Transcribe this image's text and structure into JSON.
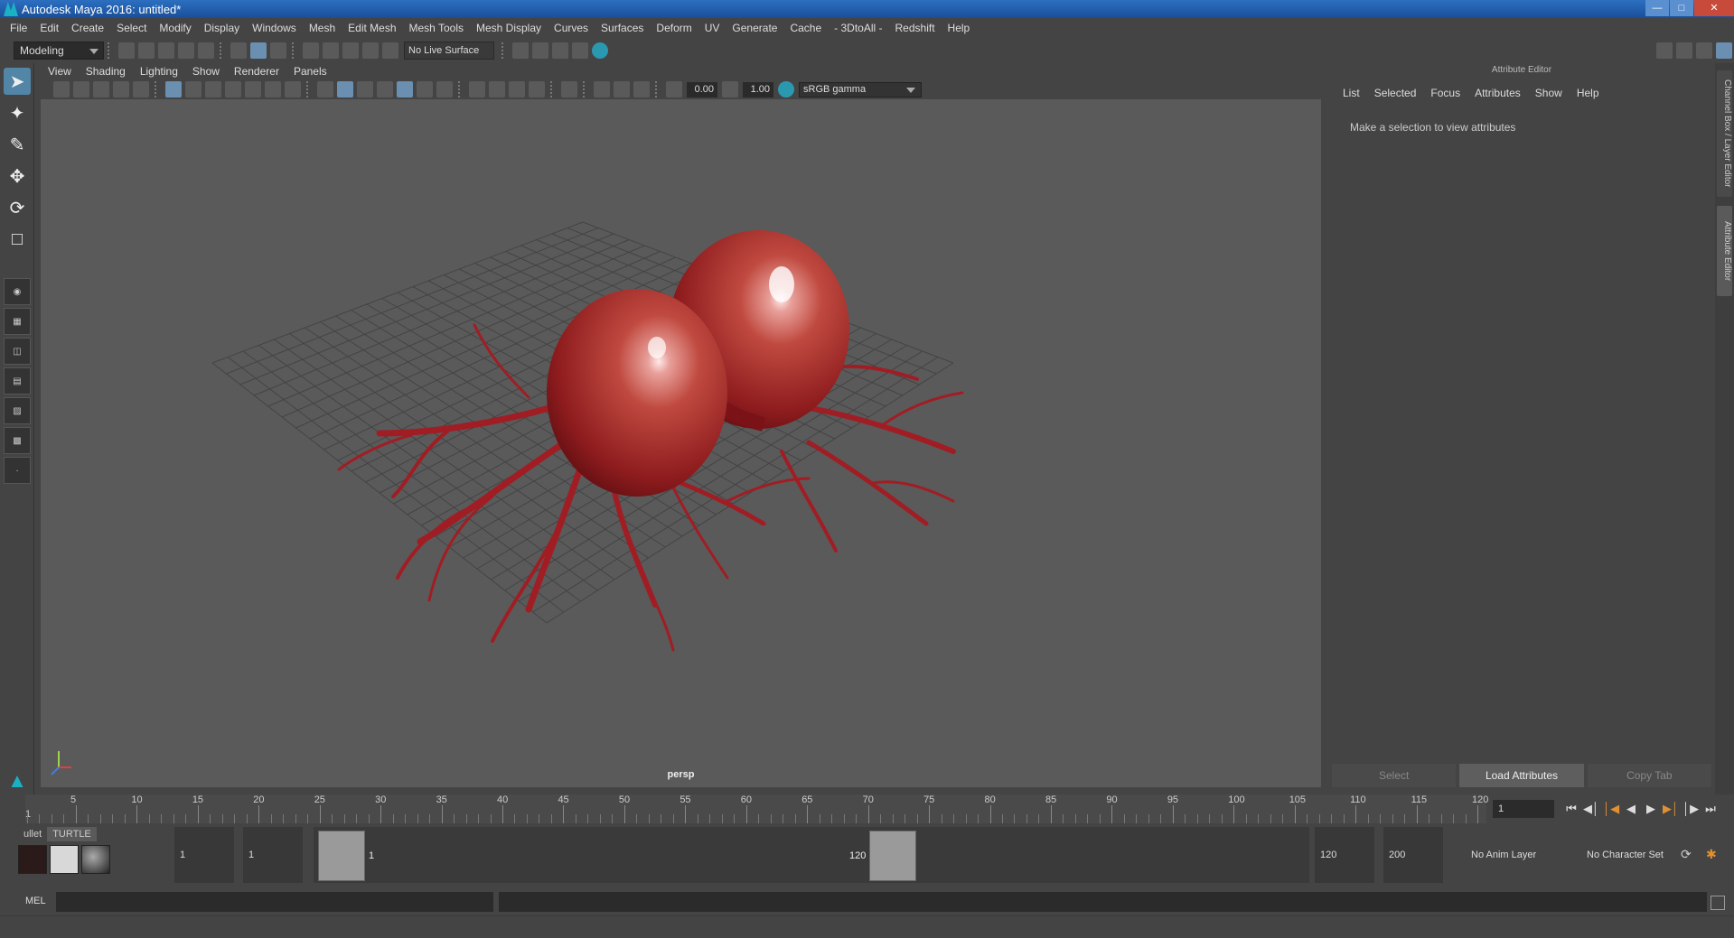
{
  "window": {
    "title": "Autodesk Maya 2016: untitled*"
  },
  "menus": [
    "File",
    "Edit",
    "Create",
    "Select",
    "Modify",
    "Display",
    "Windows",
    "Mesh",
    "Edit Mesh",
    "Mesh Tools",
    "Mesh Display",
    "Curves",
    "Surfaces",
    "Deform",
    "UV",
    "Generate",
    "Cache",
    "- 3DtoAll -",
    "Redshift",
    "Help"
  ],
  "statusline": {
    "mode": "Modeling",
    "live_surface": "No Live Surface"
  },
  "viewport": {
    "menus": [
      "View",
      "Shading",
      "Lighting",
      "Show",
      "Renderer",
      "Panels"
    ],
    "exposure": "0.00",
    "gamma": "1.00",
    "color_space": "sRGB gamma",
    "camera": "persp"
  },
  "attribute_editor": {
    "title": "Attribute Editor",
    "menus": [
      "List",
      "Selected",
      "Focus",
      "Attributes",
      "Show",
      "Help"
    ],
    "message": "Make a selection to view attributes",
    "buttons": {
      "select": "Select",
      "load": "Load Attributes",
      "copy": "Copy Tab"
    },
    "side_tabs": [
      "Channel Box / Layer Editor",
      "Attribute Editor"
    ]
  },
  "timeline": {
    "ticks": [
      "5",
      "10",
      "15",
      "20",
      "25",
      "30",
      "35",
      "40",
      "45",
      "50",
      "55",
      "60",
      "65",
      "70",
      "75",
      "80",
      "85",
      "90",
      "95",
      "100",
      "105",
      "110",
      "115",
      "120"
    ],
    "start_label": "1",
    "current_frame": "1"
  },
  "range": {
    "shelf_tabs": [
      "ullet",
      "TURTLE"
    ],
    "start": "1",
    "playback_start": "1",
    "range_start_label": "1",
    "range_end_label": "120",
    "playback_end": "120",
    "end": "200",
    "anim_layer": "No Anim Layer",
    "character_set": "No Character Set"
  },
  "command_line": {
    "label": "MEL"
  },
  "colors": {
    "accent": "#5285a6",
    "viewport_bg": "#5a5a5a",
    "mesh": "#a11d24"
  }
}
